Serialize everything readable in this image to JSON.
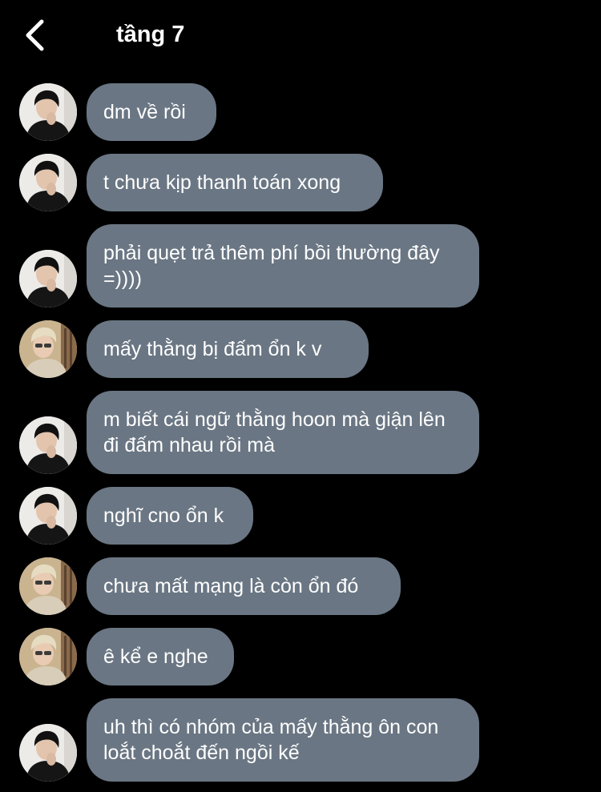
{
  "header": {
    "title": "tầng 7"
  },
  "messages": [
    {
      "text": "dm về rồi",
      "sender": "boy-dark-hair"
    },
    {
      "text": "t chưa kịp thanh toán xong",
      "sender": "boy-dark-hair"
    },
    {
      "text": "phải quẹt trả thêm phí bồi thường đây =))))",
      "sender": "boy-dark-hair"
    },
    {
      "text": "mấy thằng bị đấm ổn k v",
      "sender": "boy-blond-hair"
    },
    {
      "text": "m biết cái ngữ thằng hoon mà giận lên đi đấm nhau rồi mà",
      "sender": "boy-dark-hair"
    },
    {
      "text": "nghĩ cno ổn k",
      "sender": "boy-dark-hair"
    },
    {
      "text": "chưa mất mạng là còn ổn đó",
      "sender": "boy-blond-hair"
    },
    {
      "text": "ê kể e nghe",
      "sender": "boy-blond-hair"
    },
    {
      "text": "uh thì có nhóm của mấy thằng ôn con loắt choắt đến ngồi kế",
      "sender": "boy-dark-hair"
    }
  ],
  "colors": {
    "background": "#000000",
    "bubble": "#6a7683",
    "text": "#ffffff"
  }
}
